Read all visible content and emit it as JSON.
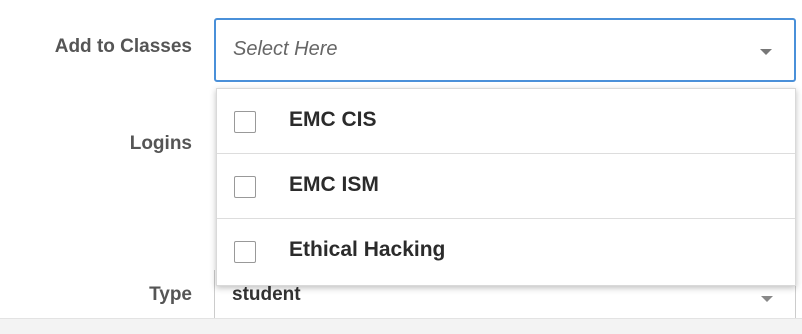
{
  "form": {
    "classes_label": "Add to Classes",
    "classes_placeholder": "Select Here",
    "logins_label": "Logins",
    "type_label": "Type",
    "type_value": "student"
  },
  "dropdown": {
    "options": [
      {
        "label": "EMC CIS",
        "checked": false
      },
      {
        "label": "EMC ISM",
        "checked": false
      },
      {
        "label": "Ethical Hacking",
        "checked": false
      }
    ]
  },
  "colors": {
    "focus_border": "#4a90d9",
    "label_text": "#555555"
  },
  "icons": {
    "select_caret": "chevron-down-icon",
    "checkbox": "checkbox-unchecked-icon"
  }
}
